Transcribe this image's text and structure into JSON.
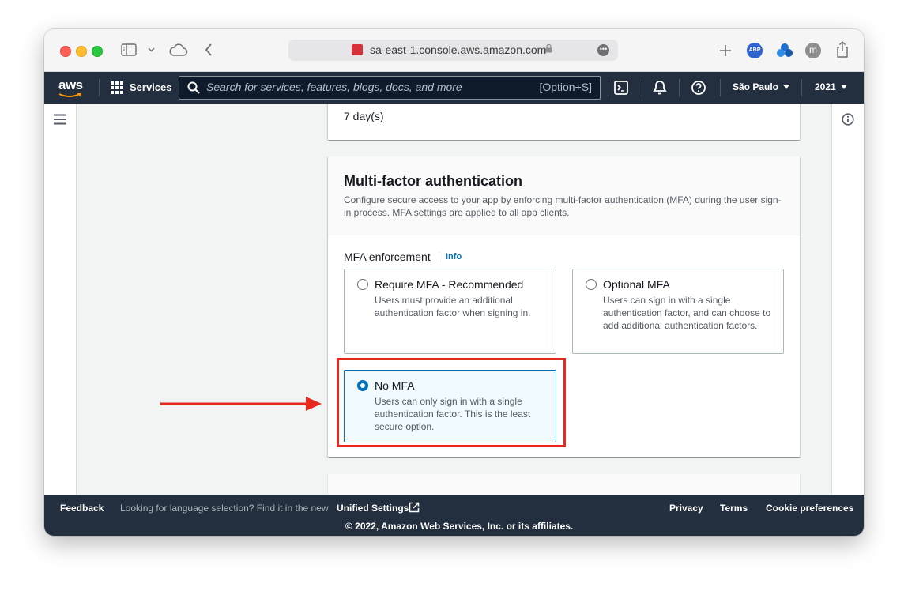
{
  "browser": {
    "url": "sa-east-1.console.aws.amazon.com"
  },
  "aws_nav": {
    "logo": "aws",
    "services_label": "Services",
    "search_placeholder": "Search for services, features, blogs, docs, and more",
    "search_shortcut": "[Option+S]",
    "region": "São Paulo",
    "account": "2021"
  },
  "content": {
    "previous_card_value": "7 day(s)",
    "mfa_card": {
      "title": "Multi-factor authentication",
      "description": "Configure secure access to your app by enforcing multi-factor authentication (MFA) during the user sign-in process. MFA settings are applied to all app clients.",
      "field_label": "MFA enforcement",
      "info_link": "Info",
      "options": [
        {
          "title": "Require MFA - Recommended",
          "description": "Users must provide an additional authentication factor when signing in.",
          "selected": false
        },
        {
          "title": "Optional MFA",
          "description": "Users can sign in with a single authentication factor, and can choose to add additional authentication factors.",
          "selected": false
        },
        {
          "title": "No MFA",
          "description": "Users can only sign in with a single authentication factor. This is the least secure option.",
          "selected": true
        }
      ]
    }
  },
  "footer": {
    "feedback": "Feedback",
    "language_notice": "Looking for language selection? Find it in the new",
    "unified_settings": "Unified Settings",
    "privacy": "Privacy",
    "terms": "Terms",
    "cookie_preferences": "Cookie preferences",
    "copyright": "© 2022, Amazon Web Services, Inc. or its affiliates."
  },
  "colors": {
    "aws_nav_bg": "#232f3e",
    "selected_blue": "#0073bb",
    "annotation_red": "#e8281f"
  }
}
